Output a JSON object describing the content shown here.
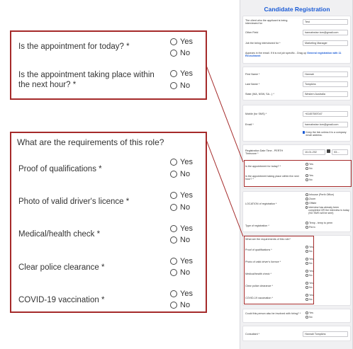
{
  "form": {
    "title": "Candidate Registration",
    "client_label": "The client who the applicant is being interviewed for",
    "client_value": "Test",
    "other_label": "Other Field",
    "other_value": "hannahwise.tom@gmail.com",
    "job_label": "Job the being interviewed for *",
    "job_value": "Marketing Manager",
    "note": "Appears in the email. If it is not job specific - Drag up",
    "note_link": "General registration with 11 Recruitment",
    "first_label": "First Name *",
    "first_value": "Hannah",
    "last_label": "Last Name *",
    "last_value": "Tompkins",
    "state_label": "State (WA, NSW, SA...) *",
    "state_value": "Western Australia",
    "mobile_label": "Mobile (for SMS) *",
    "mobile_value": "+61457587047",
    "email_label": "Email *",
    "email_value": "hannahwise.tom@gmail.com",
    "keep_text": "Keep the tick unless it is a company email address.",
    "regdate_label": "Registration Date Time - PERTH Timezone *",
    "regdate_value": "10-01-202",
    "regtime_value": "03:...",
    "location_label": "LOCATION of registration *",
    "location_opts": [
      "Inhouse (Perth Office)",
      "Zoom",
      "Offsite",
      "Interview has already been completed OR the interview is today (NO SMS will be sent)"
    ],
    "type_label": "Type of registration *",
    "type_opts": [
      "Temp - temp to perm",
      "Perm"
    ],
    "involved_label": "Could this person also be involved with hiring? *",
    "consultant_label": "Consultant *",
    "consultant_value": "Hannah Tompkins"
  },
  "appointment": {
    "q1": "Is the appointment for today? *",
    "q2": "Is the appointment taking place within the next hour? *"
  },
  "requirements": {
    "heading": "What are the requirements of this role?",
    "items": [
      "Proof of qualifications *",
      "Photo of valid driver's licence *",
      "Medical/health check *",
      "Clear police clearance *",
      "COVID-19 vaccination *"
    ]
  },
  "opts": {
    "yes": "Yes",
    "no": "No",
    "yes_small": "Yes",
    "no_small": "No"
  },
  "colors": {
    "accent": "#1a5bd6",
    "callout_border": "#a52a2a"
  }
}
